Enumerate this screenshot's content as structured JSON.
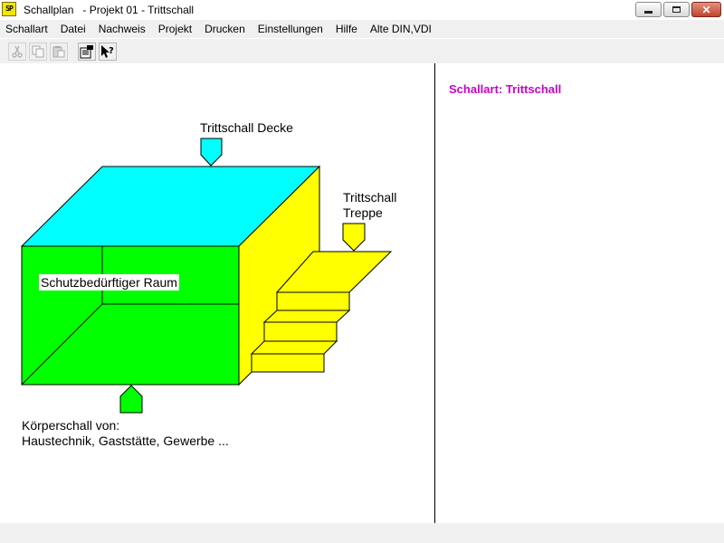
{
  "window": {
    "logo_text": "SP",
    "title": "Schallplan   - Projekt 01 - Trittschall"
  },
  "menu": {
    "items": [
      "Schallart",
      "Datei",
      "Nachweis",
      "Projekt",
      "Drucken",
      "Einstellungen",
      "Hilfe",
      "Alte DIN,VDI"
    ]
  },
  "toolbar": {
    "buttons": [
      {
        "icon": "scissors-icon",
        "enabled": false
      },
      {
        "icon": "copy-icon",
        "enabled": false
      },
      {
        "icon": "paste-icon",
        "enabled": false
      },
      {
        "icon": "properties-icon",
        "enabled": true
      },
      {
        "icon": "context-help-icon",
        "enabled": true
      }
    ]
  },
  "diagram": {
    "label_ceiling": "Trittschall Decke",
    "label_stairs_line1": "Trittschall",
    "label_stairs_line2": "Treppe",
    "label_room": "Schutzbedürftiger Raum",
    "label_structure_line1": "Körperschall von:",
    "label_structure_line2": "Haustechnik, Gaststätte, Gewerbe ...",
    "colors": {
      "ceiling": "#00ffff",
      "stairs_wall": "#ffff00",
      "room": "#00ff00",
      "outline": "#000000"
    }
  },
  "right_panel": {
    "heading": "Schallart: Trittschall",
    "heading_color": "#cc00cc"
  }
}
